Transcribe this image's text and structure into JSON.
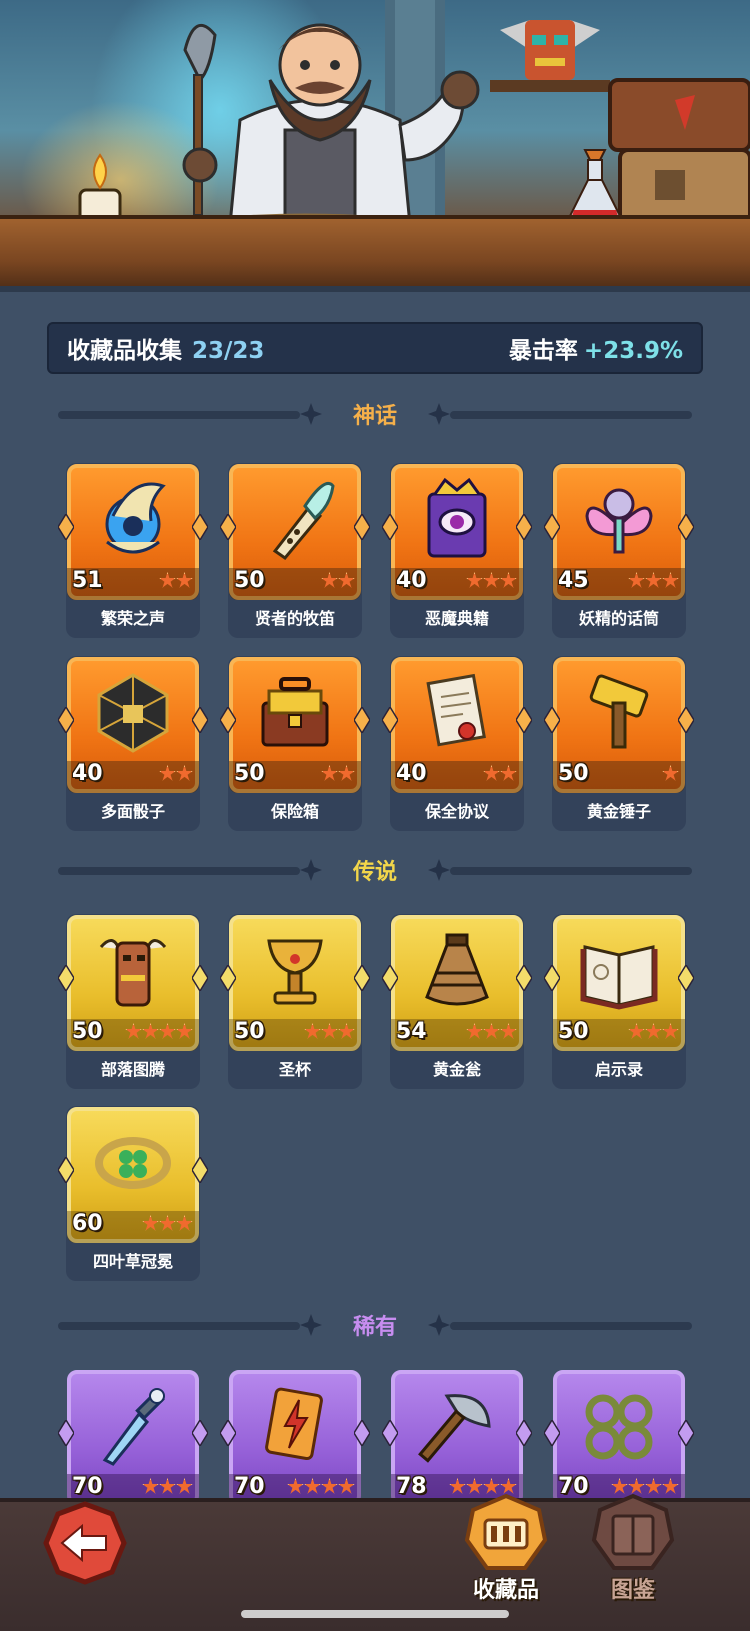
{
  "header": {
    "collection_label": "收藏品收集",
    "collection_count": "23/23",
    "crit_label": "暴击率",
    "crit_value": "+23.9%"
  },
  "sections": [
    {
      "title": "神话",
      "title_color": "#f5b04a",
      "items": [
        {
          "name": "繁荣之声",
          "level": "51",
          "stars": 2,
          "icon": "blue-spirit-icon"
        },
        {
          "name": "贤者的牧笛",
          "level": "50",
          "stars": 2,
          "icon": "feather-flute-icon"
        },
        {
          "name": "恶魔典籍",
          "level": "40",
          "stars": 3,
          "icon": "demon-book-icon"
        },
        {
          "name": "妖精的话筒",
          "level": "45",
          "stars": 3,
          "icon": "fairy-microphone-icon"
        },
        {
          "name": "多面骰子",
          "level": "40",
          "stars": 2,
          "icon": "polyhedral-dice-icon"
        },
        {
          "name": "保险箱",
          "level": "50",
          "stars": 2,
          "icon": "gold-chest-icon"
        },
        {
          "name": "保全协议",
          "level": "40",
          "stars": 2,
          "icon": "contract-scroll-icon"
        },
        {
          "name": "黄金锤子",
          "level": "50",
          "stars": 1,
          "icon": "golden-hammer-icon"
        }
      ]
    },
    {
      "title": "传说",
      "title_color": "#f2d64a",
      "items": [
        {
          "name": "部落图腾",
          "level": "50",
          "stars": 4,
          "icon": "tribal-totem-icon"
        },
        {
          "name": "圣杯",
          "level": "50",
          "stars": 3,
          "icon": "holy-grail-icon"
        },
        {
          "name": "黄金瓮",
          "level": "54",
          "stars": 3,
          "icon": "golden-urn-icon"
        },
        {
          "name": "启示录",
          "level": "50",
          "stars": 3,
          "icon": "open-book-icon"
        },
        {
          "name": "四叶草冠冕",
          "level": "60",
          "stars": 3,
          "icon": "clover-crown-icon"
        }
      ]
    },
    {
      "title": "稀有",
      "title_color": "#c78df0",
      "items": [
        {
          "name": "",
          "level": "70",
          "stars": 3,
          "icon": "ice-dagger-icon"
        },
        {
          "name": "",
          "level": "70",
          "stars": 4,
          "icon": "lightning-card-icon"
        },
        {
          "name": "",
          "level": "78",
          "stars": 4,
          "icon": "battle-axe-icon"
        },
        {
          "name": "",
          "level": "70",
          "stars": 4,
          "icon": "vine-knuckles-icon"
        }
      ]
    }
  ],
  "nav": {
    "collection_label": "收藏品",
    "codex_label": "图鉴"
  }
}
